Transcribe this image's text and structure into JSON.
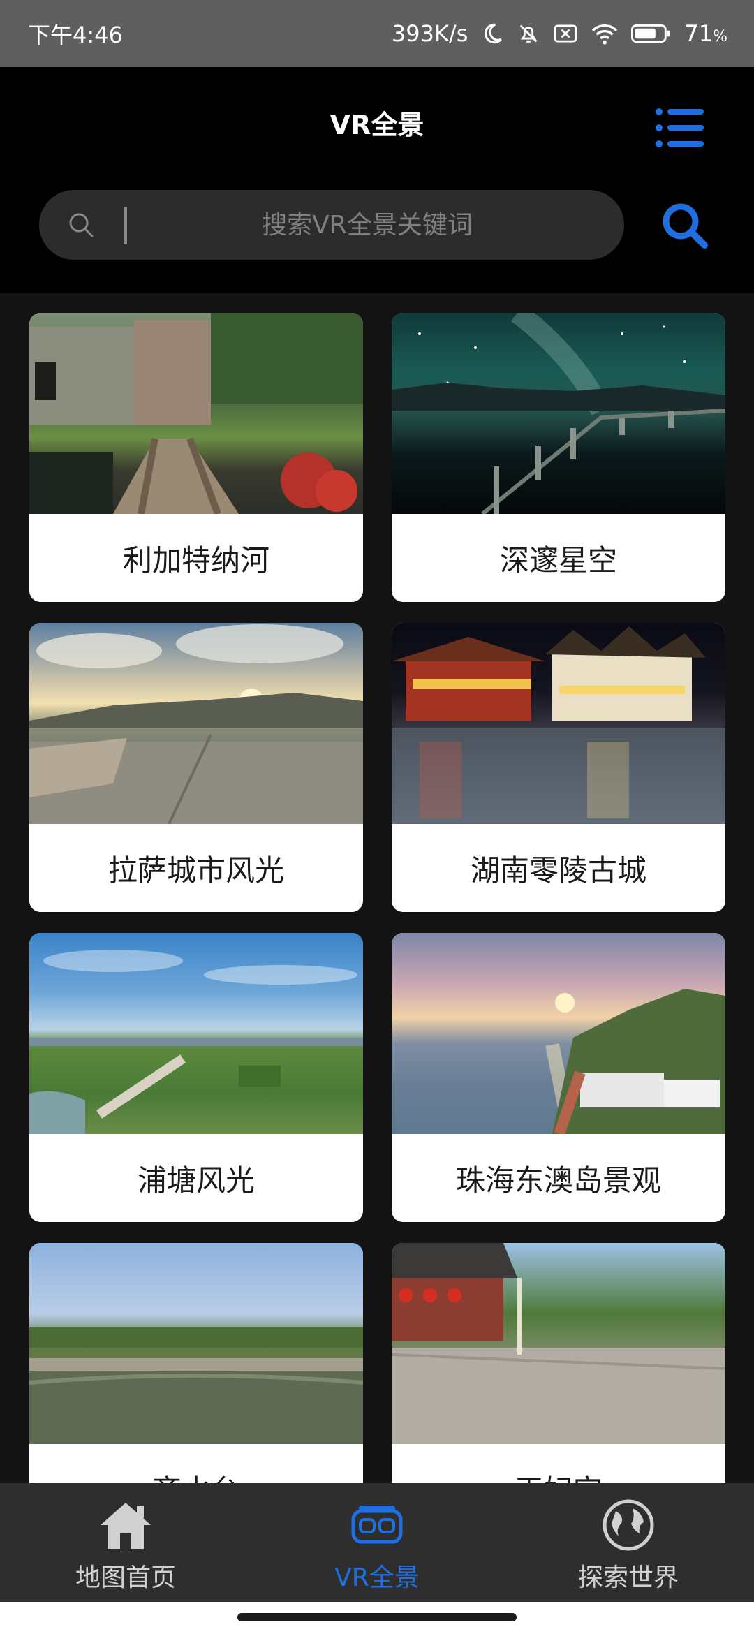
{
  "status_bar": {
    "time": "下午4:46",
    "network_speed": "393K/s",
    "battery": "71",
    "battery_unit": "%"
  },
  "header": {
    "title": "VR全景"
  },
  "search": {
    "placeholder": "搜索VR全景关键词"
  },
  "cards": [
    {
      "title": "利加特纳河"
    },
    {
      "title": "深邃星空"
    },
    {
      "title": "拉萨城市风光"
    },
    {
      "title": "湖南零陵古城"
    },
    {
      "title": "浦塘风光"
    },
    {
      "title": "珠海东澳岛景观"
    },
    {
      "title": "齐水台"
    },
    {
      "title": "天妃宫"
    }
  ],
  "bottom_nav": [
    {
      "label": "地图首页",
      "icon": "home-icon",
      "active": false
    },
    {
      "label": "VR全景",
      "icon": "vr-headset-icon",
      "active": true
    },
    {
      "label": "探索世界",
      "icon": "globe-icon",
      "active": false
    }
  ],
  "colors": {
    "accent": "#1f6fe0",
    "header_bg": "#000000",
    "page_bg": "#131313",
    "nav_bg": "#2e2e2e"
  }
}
